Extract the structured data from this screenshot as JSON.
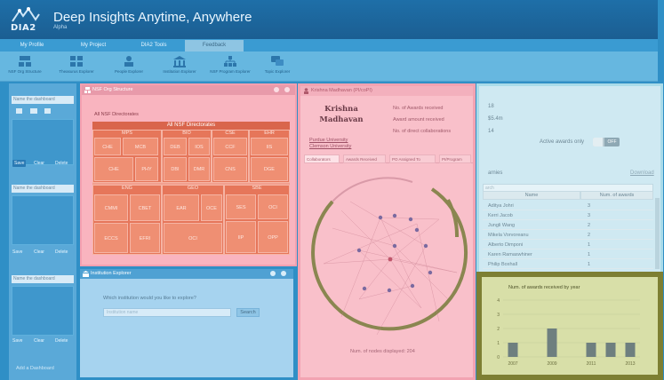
{
  "header": {
    "logo_text": "DIA2",
    "title": "Deep Insights Anytime, Anywhere",
    "subtitle": "Alpha"
  },
  "nav": {
    "tabs": [
      "My Profile",
      "My Project",
      "DIA2 Tools",
      "Feedback"
    ],
    "active_tab": "Feedback"
  },
  "toolbar": {
    "tools": [
      {
        "label": "NSF Org Structure",
        "icon": "org-chart-icon"
      },
      {
        "label": "Theasurus Explorer",
        "icon": "grid-icon"
      },
      {
        "label": "People Explorer",
        "icon": "people-icon"
      },
      {
        "label": "Institution Explorer",
        "icon": "building-icon"
      },
      {
        "label": "NSF Program Explorer",
        "icon": "hierarchy-icon"
      },
      {
        "label": "Topic Explorer",
        "icon": "chat-icon"
      }
    ]
  },
  "left_panel": {
    "dashboards": [
      {
        "name_placeholder": "Name the dashboard",
        "buttons": [
          "Save",
          "Clear",
          "Delete"
        ]
      },
      {
        "name_placeholder": "Name the dashboard",
        "buttons": [
          "Save",
          "Clear",
          "Delete"
        ]
      },
      {
        "name_placeholder": "Name the dashboard",
        "buttons": [
          "Save",
          "Clear",
          "Delete"
        ]
      }
    ],
    "add_label": "Add a Dashboard"
  },
  "nsf_panel": {
    "title": "NSF Org Structure",
    "breadcrumb": "All NSF Directorates",
    "treemap_title": "All NSF Directorates",
    "cells": [
      "MPS",
      "BIO",
      "CSE",
      "EHR",
      "CHE",
      "MCB",
      "DEB",
      "IOS",
      "CCF",
      "IIS",
      "DGE",
      "DRL",
      "DMR",
      "PHY",
      "MCB",
      "DBI",
      "CCF",
      "CNS",
      "CHE",
      "ENG",
      "GEO",
      "CMMI",
      "CBET",
      "EAR",
      "OCE",
      "SBE",
      "OCI",
      "EFRI",
      "ECCS",
      "SES",
      "OPP",
      "IIP",
      "OCI"
    ]
  },
  "institution_panel": {
    "title": "Institution Explorer",
    "question": "Which institution would you like to explore?",
    "input_placeholder": "Institution name",
    "button_label": "Search"
  },
  "person_panel": {
    "header": "Krishna Madhavan (PI/coPI)",
    "name": "Krishna Madhavan",
    "stats": [
      "No. of Awards received",
      "Award amount received",
      "No. of direct collaborations"
    ],
    "links": [
      "Purdue University",
      "Clemson University"
    ],
    "tabs": [
      "Collaborators",
      "Awards Received",
      "PO Assigned To",
      "PI/Program"
    ],
    "footer": "Num. of nodes displayed: 204"
  },
  "awards_panel": {
    "values": [
      "18",
      "$5.4m",
      "14"
    ],
    "active_label": "Active awards only",
    "toggle_label": "OFF",
    "section_label": "arnies",
    "download_label": "Download",
    "search_placeholder": "arch",
    "columns": [
      "Name",
      "Num. of awards"
    ],
    "rows": [
      {
        "name": "Aditya Johri",
        "count": "3"
      },
      {
        "name": "Kerri Jacob",
        "count": "3"
      },
      {
        "name": "Jungli Wang",
        "count": "2"
      },
      {
        "name": "Mikela Vorvoreanu",
        "count": "2"
      },
      {
        "name": "Alberto Dimponi",
        "count": "1"
      },
      {
        "name": "Karen Ramaswhiner",
        "count": "1"
      },
      {
        "name": "Philip Boxhall",
        "count": "1"
      }
    ]
  },
  "chart_panel": {
    "chart_data": {
      "type": "bar",
      "title": "Num. of awards received by year",
      "categories": [
        "2007",
        "2008",
        "2009",
        "2010",
        "2011",
        "2012",
        "2013"
      ],
      "values": [
        1,
        0,
        2,
        0,
        1,
        1,
        1
      ],
      "x_tick_labels": [
        "2007",
        "2009",
        "2011",
        "2013"
      ],
      "ylim": [
        0,
        4
      ],
      "grid": true,
      "bar_color": "#6e7f7f"
    }
  }
}
